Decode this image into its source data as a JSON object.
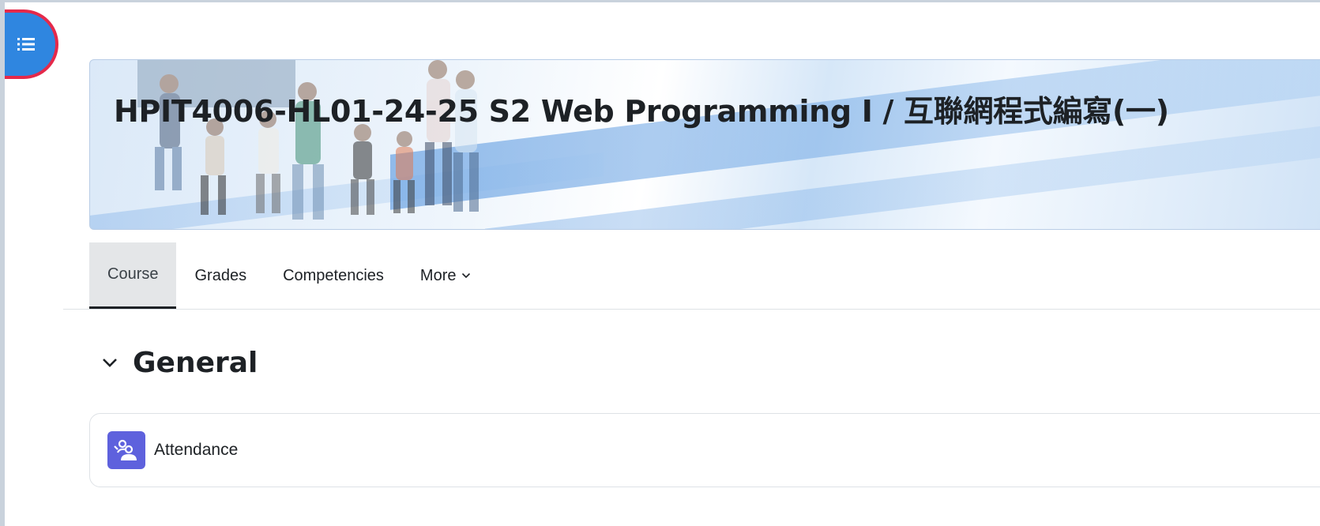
{
  "drawer": {
    "icon": "course-index-icon",
    "accent": "#2f86e0",
    "focus_ring": "#e5294a"
  },
  "banner": {
    "title": "HPIT4006-HL01-24-25 S2 Web Programming I / 互聯網程式編寫(一)",
    "image": "students-jumping-banner"
  },
  "tabs": [
    {
      "label": "Course",
      "active": true
    },
    {
      "label": "Grades",
      "active": false
    },
    {
      "label": "Competencies",
      "active": false
    },
    {
      "label": "More",
      "active": false,
      "icon": "chevron-down-icon"
    }
  ],
  "section": {
    "title": "General",
    "toggle_icon": "chevron-down-icon",
    "activities": [
      {
        "label": "Attendance",
        "icon": "attendance-icon",
        "icon_color": "#5e61dd"
      }
    ]
  }
}
